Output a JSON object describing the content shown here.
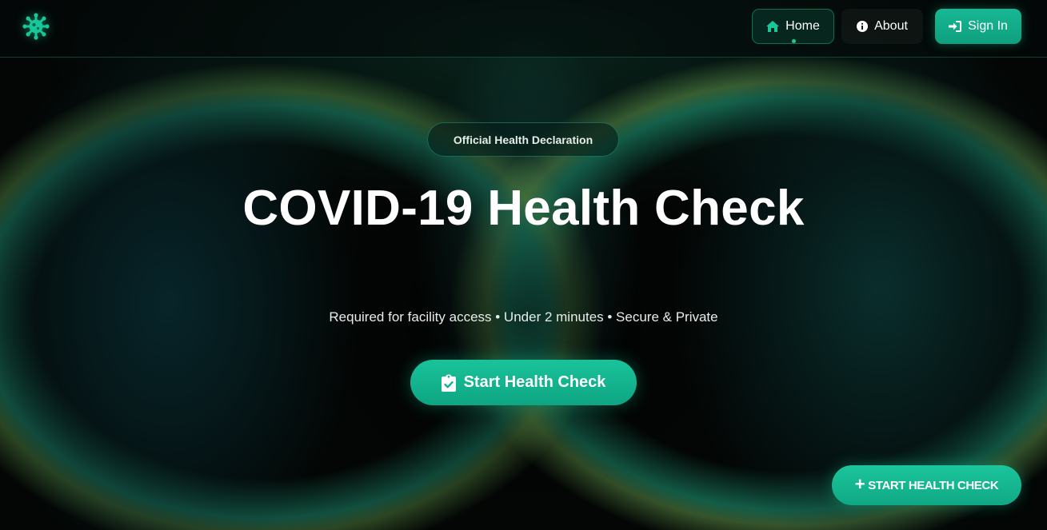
{
  "nav": {
    "logo_icon": "virus-icon",
    "home_label": "Home",
    "about_label": "About",
    "signin_label": "Sign In",
    "active_item": "Home"
  },
  "hero": {
    "badge": "Official Health Declaration",
    "title": "COVID-19 Health Check",
    "subtitle": "Required for facility access • Under 2 minutes • Secure & Private",
    "cta_label": "Start Health Check",
    "cta_icon": "clipboard-check-icon"
  },
  "fab": {
    "icon": "plus-icon",
    "label": "START HEALTH CHECK"
  },
  "colors": {
    "accent": "#10b98f",
    "accent_dark": "#0ea583",
    "background": "#030605",
    "text": "#ffffff"
  }
}
